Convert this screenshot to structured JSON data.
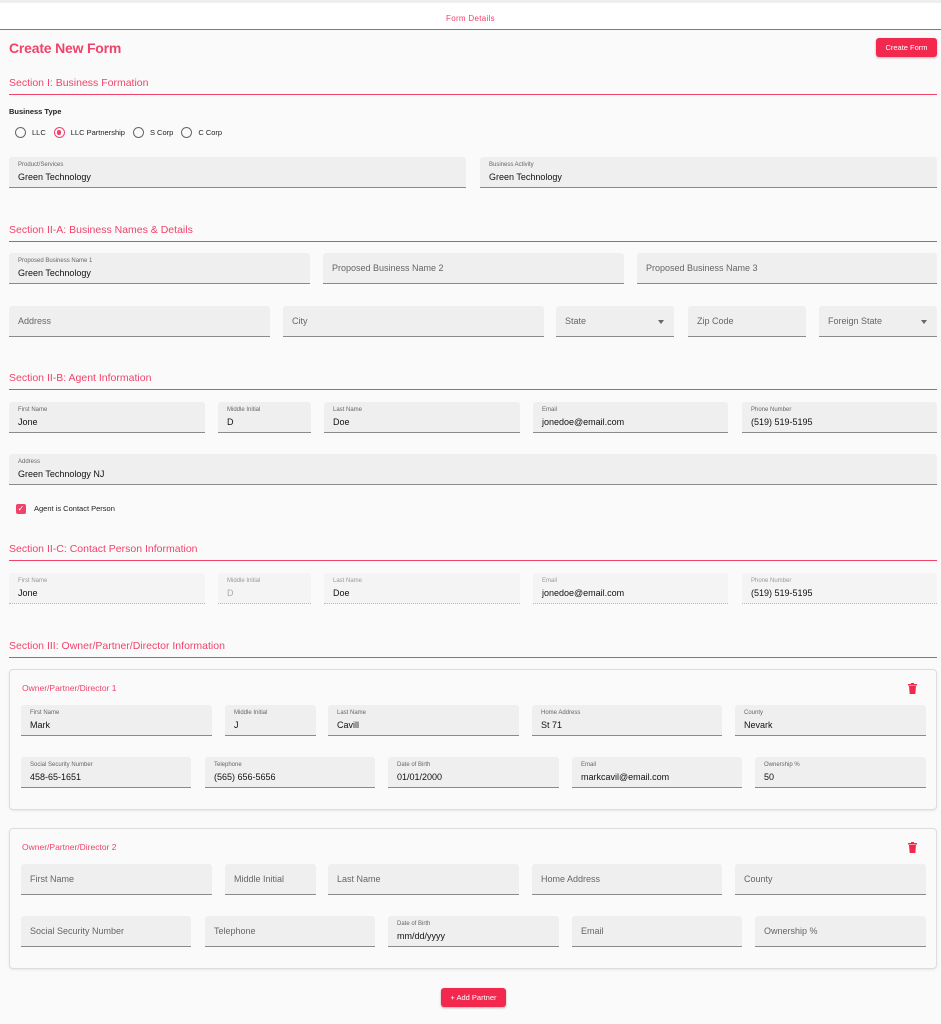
{
  "header": {
    "title": "Form Details"
  },
  "page": {
    "title": "Create New Form",
    "create_button": "Create Form"
  },
  "section1": {
    "title": "Section I: Business Formation",
    "business_type_label": "Business Type",
    "options": [
      "LLC",
      "LLC Partnership",
      "S Corp",
      "C Corp"
    ],
    "selected": "LLC Partnership",
    "product_services": {
      "label": "Product/Services",
      "value": "Green Technology"
    },
    "business_activity": {
      "label": "Business Activity",
      "value": "Green Technology"
    }
  },
  "section2a": {
    "title": "Section II-A: Business Names & Details",
    "name1": {
      "label": "Proposed Business Name 1",
      "value": "Green Technology"
    },
    "name2": {
      "placeholder": "Proposed Business Name 2"
    },
    "name3": {
      "placeholder": "Proposed Business Name 3"
    },
    "address": {
      "placeholder": "Address"
    },
    "city": {
      "placeholder": "City"
    },
    "state": {
      "placeholder": "State"
    },
    "zip": {
      "placeholder": "Zip Code"
    },
    "foreign_state": {
      "placeholder": "Foreign State"
    }
  },
  "section2b": {
    "title": "Section II-B: Agent Information",
    "first_name": {
      "label": "First Name",
      "value": "Jone"
    },
    "middle_initial": {
      "label": "Middle Initial",
      "value": "D"
    },
    "last_name": {
      "label": "Last Name",
      "value": "Doe"
    },
    "email": {
      "label": "Email",
      "value": "jonedoe@email.com"
    },
    "phone": {
      "label": "Phone Number",
      "value": "(519) 519-5195"
    },
    "address": {
      "label": "Address",
      "value": "Green Technology NJ"
    },
    "checkbox_label": "Agent is Contact Person",
    "checkbox_checked": true
  },
  "section2c": {
    "title": "Section II-C: Contact Person Information",
    "first_name": {
      "label": "First Name",
      "value": "Jone"
    },
    "middle_initial": {
      "label": "Middle Initial",
      "value": "D"
    },
    "last_name": {
      "label": "Last Name",
      "value": "Doe"
    },
    "email": {
      "label": "Email",
      "value": "jonedoe@email.com"
    },
    "phone": {
      "label": "Phone Number",
      "value": "(519) 519-5195"
    }
  },
  "section3": {
    "title": "Section III: Owner/Partner/Director Information",
    "partners": [
      {
        "title": "Owner/Partner/Director 1",
        "first_name": {
          "label": "First Name",
          "value": "Mark"
        },
        "middle_initial": {
          "label": "Middle Initial",
          "value": "J"
        },
        "last_name": {
          "label": "Last Name",
          "value": "Cavill"
        },
        "home_address": {
          "label": "Home Address",
          "value": "St 71"
        },
        "county": {
          "label": "County",
          "value": "Nevark"
        },
        "ssn": {
          "label": "Social Security Number",
          "value": "458-65-1651"
        },
        "telephone": {
          "label": "Telephone",
          "value": "(565) 656-5656"
        },
        "dob": {
          "label": "Date of Birth",
          "value": "01/01/2000"
        },
        "email": {
          "label": "Email",
          "value": "markcavil@email.com"
        },
        "ownership": {
          "label": "Ownership %",
          "value": "50"
        }
      },
      {
        "title": "Owner/Partner/Director 2",
        "first_name": {
          "placeholder": "First Name"
        },
        "middle_initial": {
          "placeholder": "Middle Initial"
        },
        "last_name": {
          "placeholder": "Last Name"
        },
        "home_address": {
          "placeholder": "Home Address"
        },
        "county": {
          "placeholder": "County"
        },
        "ssn": {
          "placeholder": "Social Security Number"
        },
        "telephone": {
          "placeholder": "Telephone"
        },
        "dob": {
          "label": "Date of Birth",
          "value": "mm/dd/yyyy"
        },
        "email": {
          "placeholder": "Email"
        },
        "ownership": {
          "placeholder": "Ownership %"
        }
      }
    ],
    "add_button": "+ Add Partner"
  },
  "colors": {
    "accent": "#f0436b",
    "button": "#f2284f",
    "field_bg": "#efefef"
  },
  "icons": {
    "delete": "trash-icon",
    "checkbox": "check-icon",
    "dropdown": "chevron-down-icon"
  }
}
